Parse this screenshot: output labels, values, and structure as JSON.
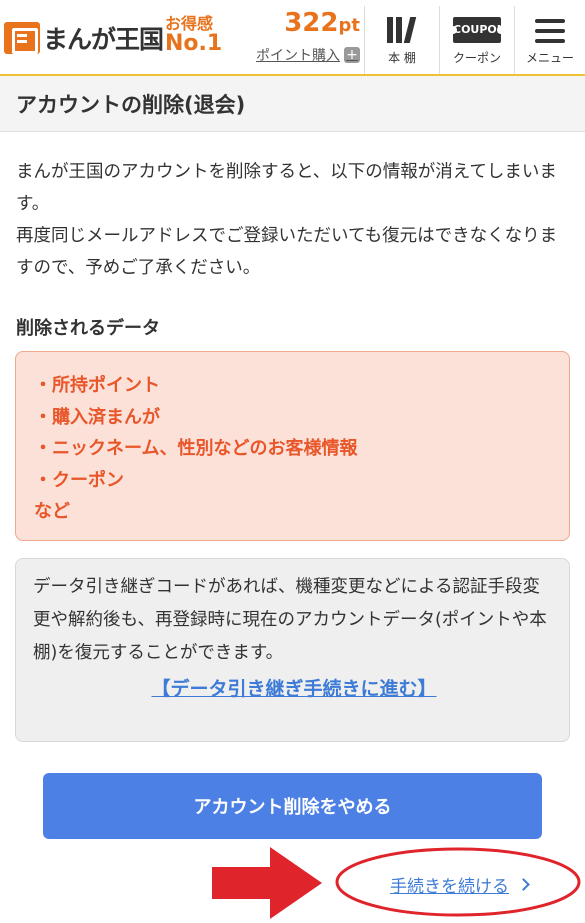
{
  "header": {
    "logo_text": "まんが王国",
    "badge_top": "お得感",
    "badge_bottom": "No.1",
    "points_value": "322",
    "points_unit": "pt",
    "buy_points_label": "ポイント購入",
    "nav": {
      "shelf_label": "本 棚",
      "coupon_icon_text": "COUPON",
      "coupon_label": "クーポン",
      "menu_label": "メニュー"
    }
  },
  "page": {
    "title": "アカウントの削除(退会)",
    "intro_1": "まんが王国のアカウントを削除すると、以下の情報が消えてしまいます。",
    "intro_2": "再度同じメールアドレスでご登録いただいても復元はできなくなりますので、予めご了承ください。",
    "deleted_heading": "削除されるデータ",
    "deleted_items": [
      "・所持ポイント",
      "・購入済まんが",
      "・ニックネーム、性別などのお客様情報",
      "・クーポン"
    ],
    "deleted_etc": "など",
    "info_text": "データ引き継ぎコードがあれば、機種変更などによる認証手段変更や解約後も、再登録時に現在のアカウントデータ(ポイントや本棚)を復元することができます。",
    "transfer_link": "【データ引き継ぎ手続きに進む】",
    "cancel_button": "アカウント削除をやめる",
    "continue_link": "手続きを続ける"
  },
  "colors": {
    "brand_orange": "#e8731c",
    "alert_red": "#e8562a",
    "link_blue": "#3d7bd6",
    "button_blue": "#4d80e4",
    "annotation_red": "#e0242b"
  }
}
